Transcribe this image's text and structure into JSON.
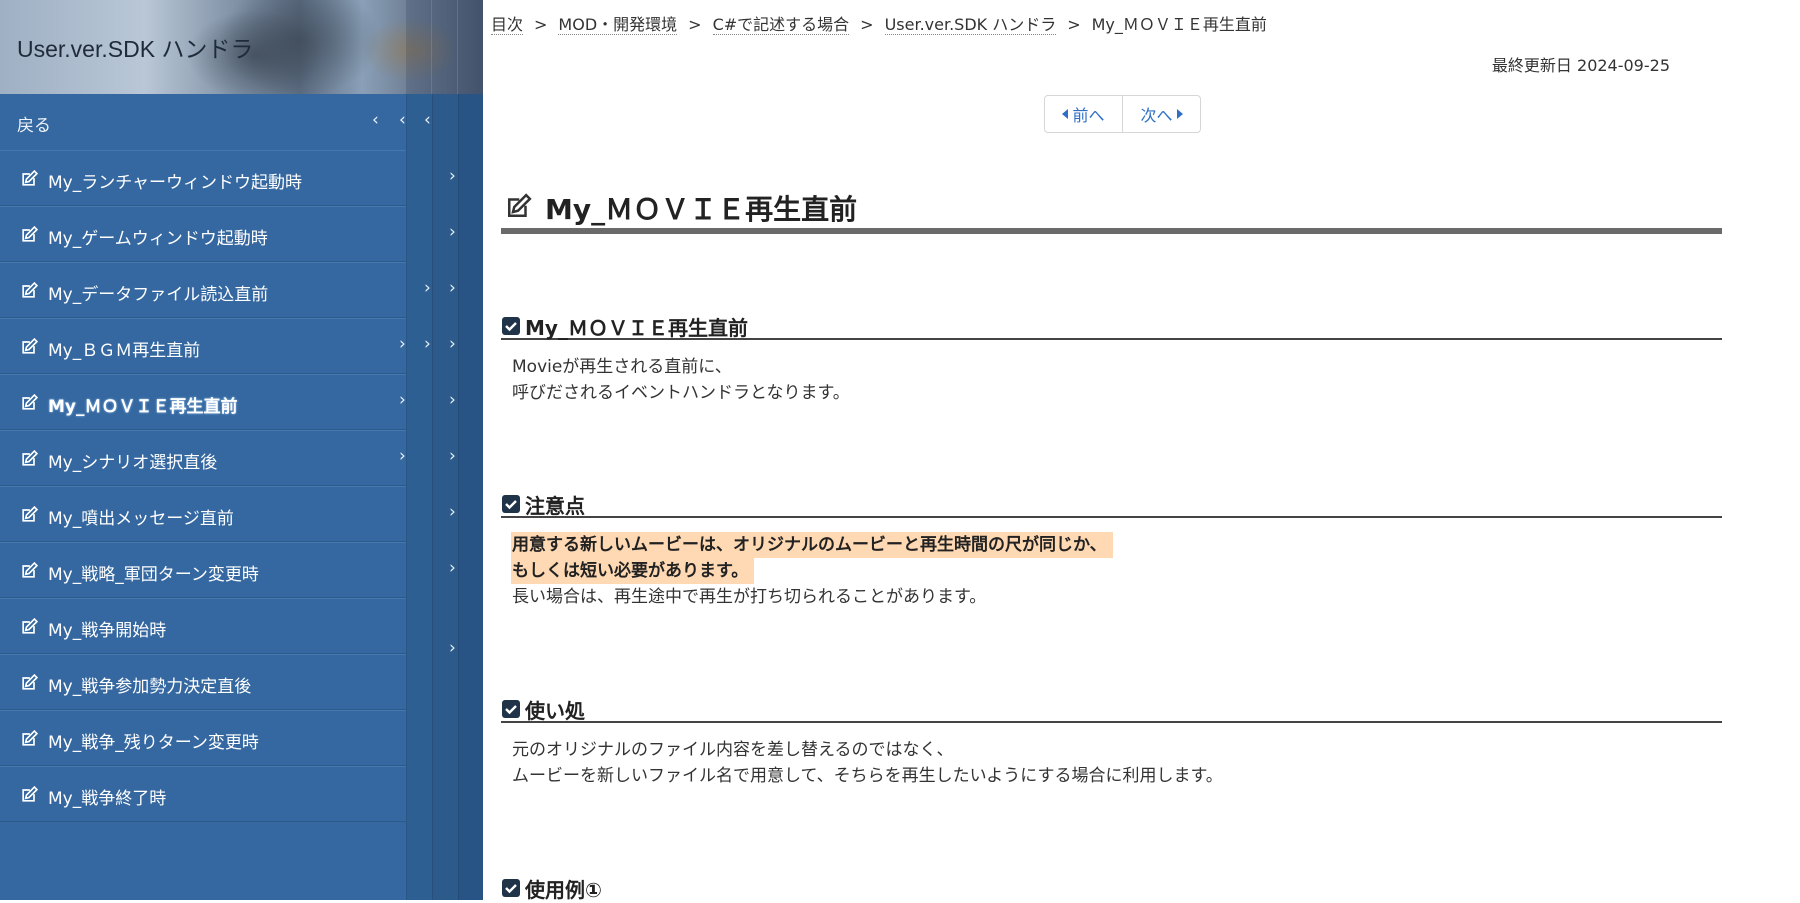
{
  "sidebar": {
    "site_title": "User.ver.SDK ハンドラ",
    "back_label": "戻る",
    "items": [
      {
        "label": "My_ランチャーウィンドウ起動時"
      },
      {
        "label": "My_ゲームウィンドウ起動時"
      },
      {
        "label": "My_データファイル読込直前"
      },
      {
        "label": "My_ＢＧＭ再生直前"
      },
      {
        "label": "My_ＭＯＶＩＥ再生直前",
        "active": true
      },
      {
        "label": "My_シナリオ選択直後"
      },
      {
        "label": "My_噴出メッセージ直前"
      },
      {
        "label": "My_戦略_軍団ターン変更時"
      },
      {
        "label": "My_戦争開始時"
      },
      {
        "label": "My_戦争参加勢力決定直後"
      },
      {
        "label": "My_戦争_残りターン変更時"
      },
      {
        "label": "My_戦争終了時"
      }
    ],
    "accent_color": "#3568a0"
  },
  "breadcrumb": {
    "items": [
      "目次",
      "MOD・開発環境",
      "C#で記述する場合",
      "User.ver.SDK ハンドラ"
    ],
    "current": "My_ＭＯＶＩＥ再生直前",
    "separator": ">"
  },
  "meta": {
    "last_updated": "最終更新日 2024-09-25"
  },
  "pager": {
    "prev_label": "前へ",
    "next_label": "次へ"
  },
  "page": {
    "title": "My_ＭＯＶＩＥ再生直前",
    "sections": [
      {
        "title": "My_ＭＯＶＩＥ再生直前",
        "lines": [
          "Movieが再生される直前に、",
          "呼びだされるイベントハンドラとなります。"
        ]
      },
      {
        "title": "注意点",
        "highlight_lines": [
          "用意する新しいムービーは、オリジナルのムービーと再生時間の尺が同じか、",
          "もしくは短い必要があります。"
        ],
        "lines": [
          "長い場合は、再生途中で再生が打ち切られることがあります。"
        ]
      },
      {
        "title": "使い処",
        "lines": [
          "元のオリジナルのファイル内容を差し替えるのではなく、",
          "ムービーを新しいファイル名で用意して、そちらを再生したいようにする場合に利用します。"
        ]
      },
      {
        "title": "使用例①"
      }
    ]
  }
}
